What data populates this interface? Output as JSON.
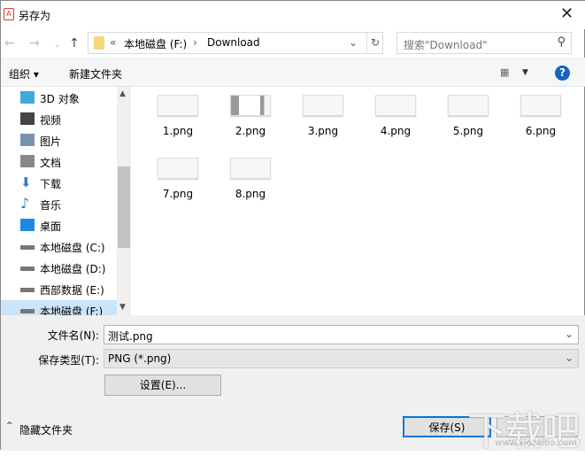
{
  "title": "另存为",
  "address": {
    "prefix": "«",
    "drive": "本地磁盘 (F:)",
    "sep": "›",
    "folder": "Download"
  },
  "search": {
    "placeholder": "搜索\"Download\""
  },
  "toolbar": {
    "organize": "组织 ▾",
    "new_folder": "新建文件夹",
    "help": "?"
  },
  "nav_items": [
    {
      "label": "3D 对象",
      "icon": "cube-icon",
      "color": "#3fa9d9"
    },
    {
      "label": "视频",
      "icon": "video-icon",
      "color": "#444"
    },
    {
      "label": "图片",
      "icon": "picture-icon",
      "color": "#7a93a8"
    },
    {
      "label": "文档",
      "icon": "document-icon",
      "color": "#888"
    },
    {
      "label": "下载",
      "icon": "download-icon",
      "color": "#2f7fd1"
    },
    {
      "label": "音乐",
      "icon": "music-icon",
      "color": "#2f7fd1"
    },
    {
      "label": "桌面",
      "icon": "desktop-icon",
      "color": "#1e88e5"
    },
    {
      "label": "本地磁盘 (C:)",
      "icon": "drive-icon",
      "color": "#777"
    },
    {
      "label": "本地磁盘 (D:)",
      "icon": "drive-icon",
      "color": "#777"
    },
    {
      "label": "西部数据 (E:)",
      "icon": "drive-icon",
      "color": "#777"
    },
    {
      "label": "本地磁盘 (F:)",
      "icon": "drive-icon",
      "color": "#777"
    }
  ],
  "files": [
    "1.png",
    "2.png",
    "3.png",
    "4.png",
    "5.png",
    "6.png",
    "7.png",
    "8.png"
  ],
  "form": {
    "filename_label": "文件名(N):",
    "filename_value": "测试.png",
    "type_label": "保存类型(T):",
    "type_value": "PNG (*.png)",
    "settings_button": "设置(E)..."
  },
  "footer": {
    "hide_folders": "隐藏文件夹",
    "save_button": "保存(S)"
  },
  "watermark": {
    "text": "下载吧",
    "url": "www.xiazaiba.com"
  }
}
